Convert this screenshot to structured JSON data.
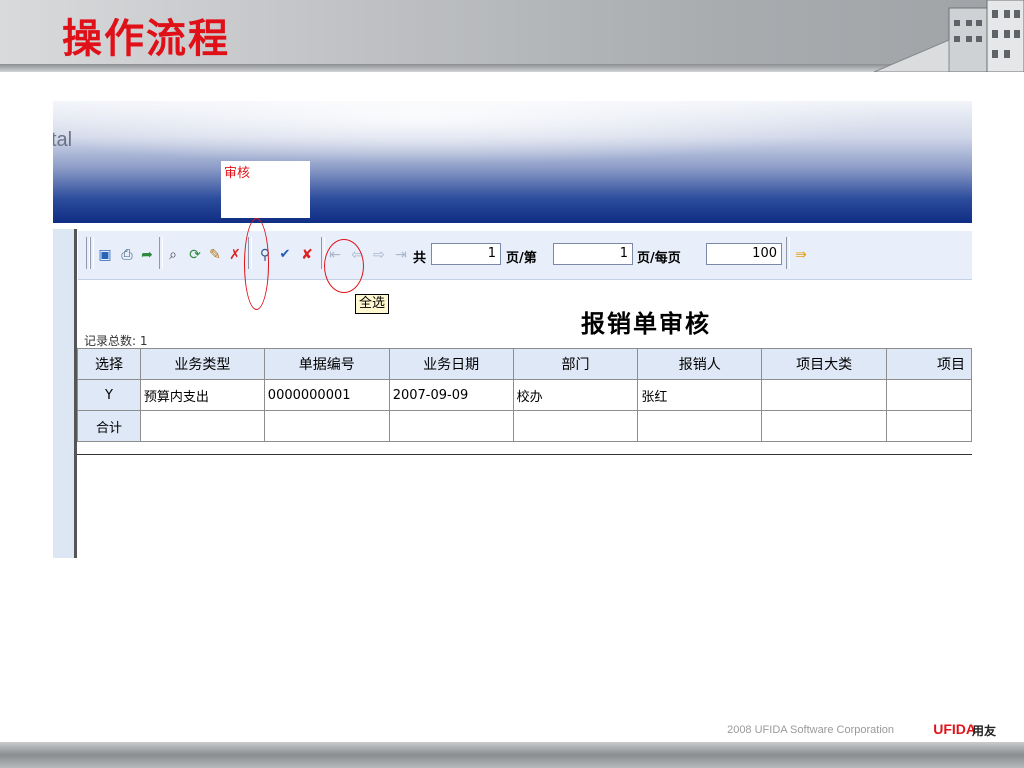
{
  "slide": {
    "title": "操作流程",
    "footer_text": "2008 UFIDA Software Corporation",
    "footer_brand": "UFIDA",
    "footer_brand_cn": "用友"
  },
  "app": {
    "banner_text": "tal",
    "active_tab": "审核"
  },
  "toolbar": {
    "total_label": "共",
    "total_pages": "1",
    "page_unit": "页/第",
    "current_page": "1",
    "per_page_label": "页/每页",
    "per_page": "100"
  },
  "tooltip": "全选",
  "record_count": "记录总数: 1",
  "report_title": "报销单审核",
  "table": {
    "headers": [
      "选择",
      "业务类型",
      "单据编号",
      "业务日期",
      "部门",
      "报销人",
      "项目大类",
      "项目"
    ],
    "rows": [
      [
        "Y",
        "预算内支出",
        "0000000001",
        "2007-09-09",
        "校办",
        "张红",
        "",
        ""
      ]
    ],
    "total_row_label": "合计"
  },
  "icons": [
    "preview-icon",
    "print-icon",
    "export-icon",
    "find-icon",
    "refresh-icon",
    "audit-icon",
    "unaudit-icon",
    "filter-icon",
    "select-all-icon",
    "deselect-all-icon",
    "first-page-icon",
    "prev-page-icon",
    "next-page-icon",
    "last-page-icon",
    "exit-icon"
  ],
  "colors": {
    "title_red": "#e01019",
    "annotation_red": "#e0141b",
    "banner_blue": "#0f2d84"
  }
}
